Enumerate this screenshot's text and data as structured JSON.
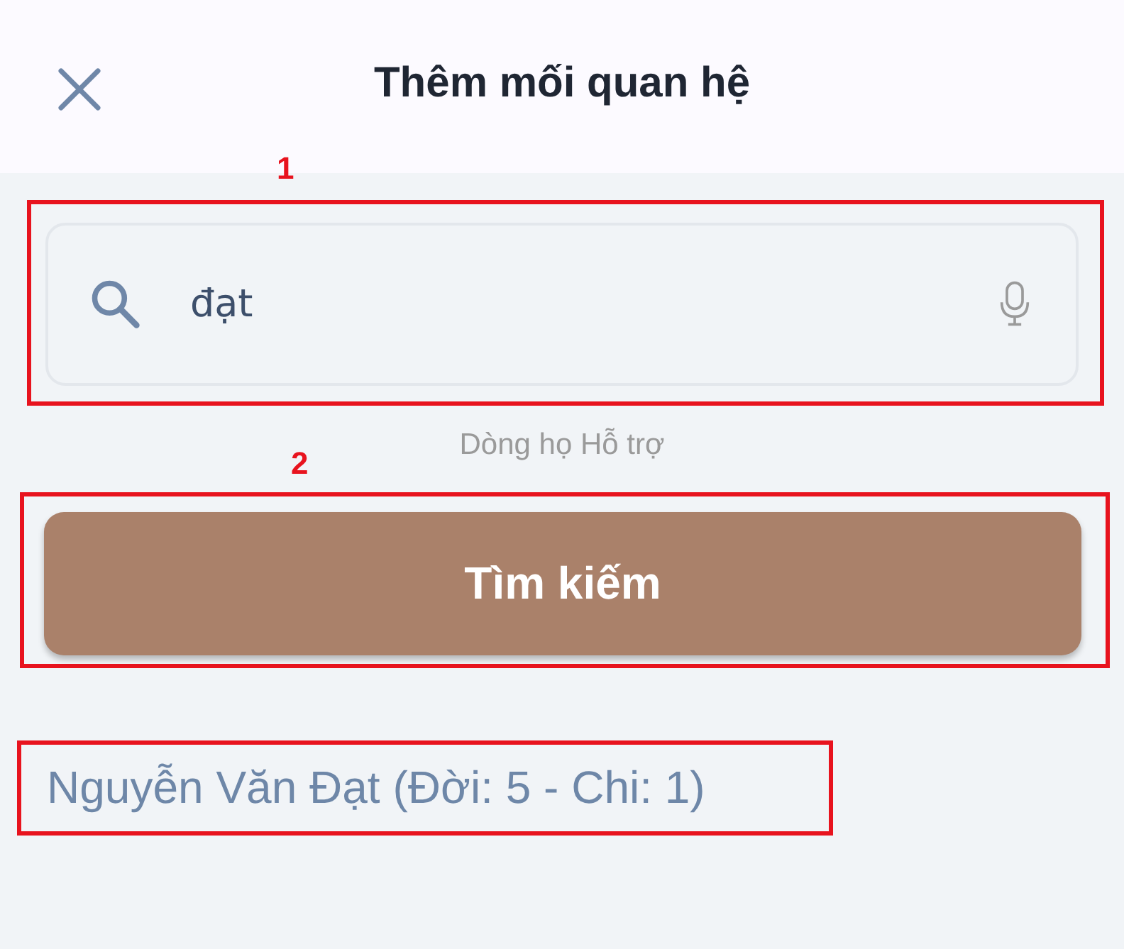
{
  "header": {
    "title": "Thêm mối quan hệ"
  },
  "search": {
    "value": "đạt"
  },
  "helper_text": "Dòng họ Hỗ trợ",
  "search_button": {
    "label": "Tìm kiếm"
  },
  "results": [
    {
      "text": "Nguyễn Văn Đạt (Đời: 5 - Chi: 1)"
    }
  ],
  "annotations": [
    {
      "label": "1"
    },
    {
      "label": "2"
    }
  ]
}
